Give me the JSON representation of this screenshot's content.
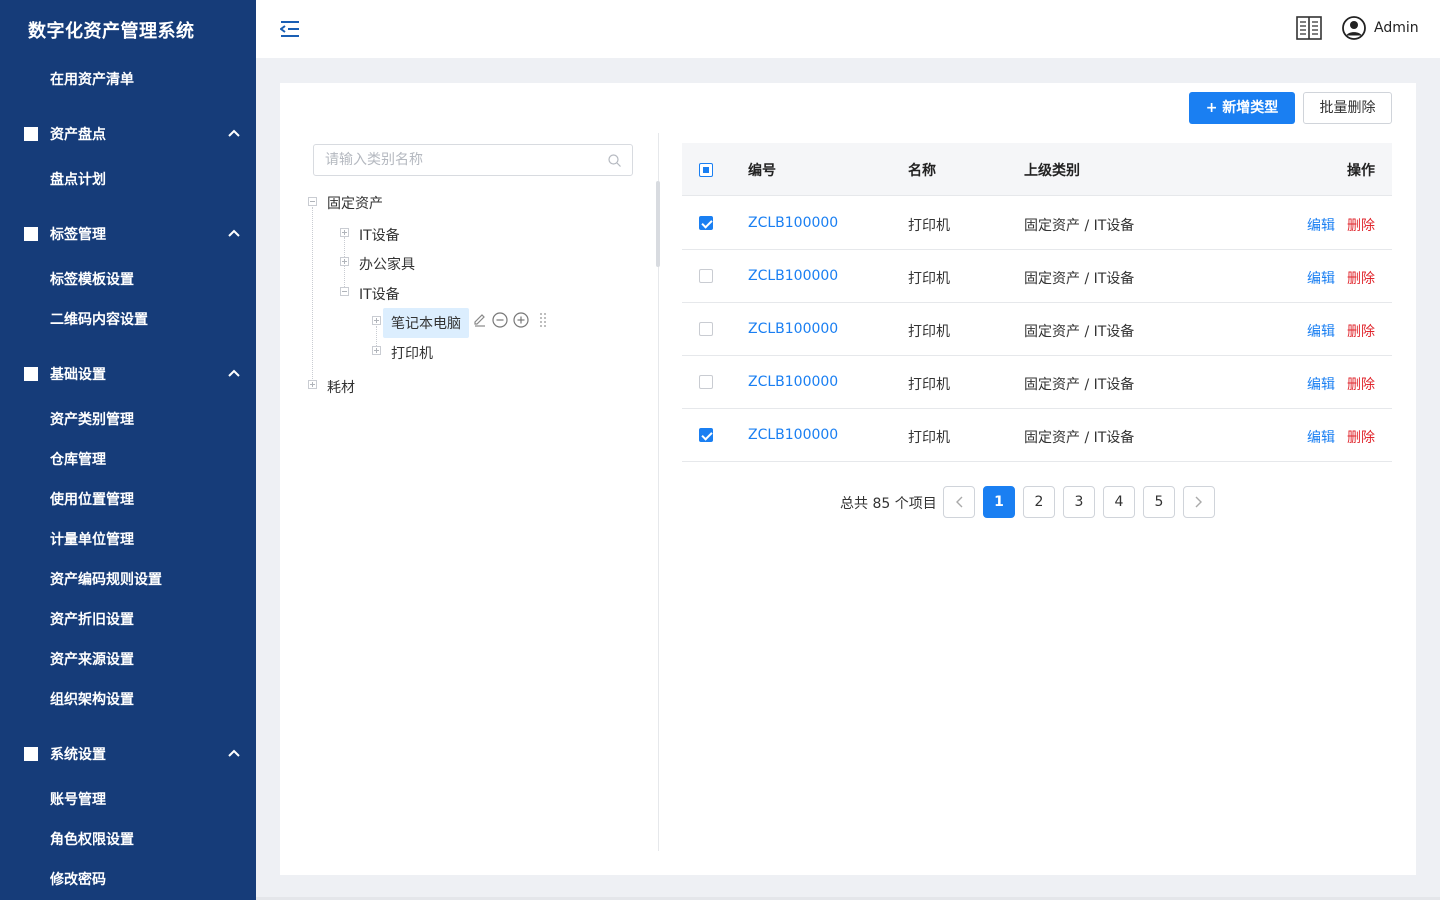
{
  "app": {
    "title": "数字化资产管理系统"
  },
  "sidebar": {
    "top_item": "在用资产清单",
    "groups": [
      {
        "label": "资产盘点",
        "items": [
          "盘点计划"
        ]
      },
      {
        "label": "标签管理",
        "items": [
          "标签模板设置",
          "二维码内容设置"
        ]
      },
      {
        "label": "基础设置",
        "items": [
          "资产类别管理",
          "仓库管理",
          "使用位置管理",
          "计量单位管理",
          "资产编码规则设置",
          "资产折旧设置",
          "资产来源设置",
          "组织架构设置"
        ]
      },
      {
        "label": "系统设置",
        "items": [
          "账号管理",
          "角色权限设置",
          "修改密码"
        ]
      }
    ]
  },
  "header": {
    "user": "Admin",
    "icons": [
      "menu-fold-icon",
      "book-icon",
      "user-circle-icon"
    ]
  },
  "toolbar": {
    "add_label": "+ 新增类型",
    "batch_delete_label": "批量删除"
  },
  "tree": {
    "search_placeholder": "请输入类别名称",
    "nodes": {
      "root1": "固定资产",
      "child1": "IT设备",
      "child2": "办公家具",
      "child3": "IT设备",
      "leaf1": "笔记本电脑",
      "leaf2": "打印机",
      "root2": "耗材"
    }
  },
  "table": {
    "columns": {
      "code": "编号",
      "name": "名称",
      "parent": "上级类别",
      "ops": "操作"
    },
    "edit_label": "编辑",
    "delete_label": "删除",
    "rows": [
      {
        "checked": true,
        "code": "ZCLB100000",
        "name": "打印机",
        "parent": "固定资产 / IT设备"
      },
      {
        "checked": false,
        "code": "ZCLB100000",
        "name": "打印机",
        "parent": "固定资产 / IT设备"
      },
      {
        "checked": false,
        "code": "ZCLB100000",
        "name": "打印机",
        "parent": "固定资产 / IT设备"
      },
      {
        "checked": false,
        "code": "ZCLB100000",
        "name": "打印机",
        "parent": "固定资产 / IT设备"
      },
      {
        "checked": true,
        "code": "ZCLB100000",
        "name": "打印机",
        "parent": "固定资产 / IT设备"
      }
    ]
  },
  "pagination": {
    "total_text": "总共 85 个项目",
    "pages": [
      "1",
      "2",
      "3",
      "4",
      "5"
    ],
    "current": "1"
  },
  "colors": {
    "sidebar_bg": "#163c79",
    "primary": "#1a7ff2",
    "danger": "#e0262d"
  }
}
